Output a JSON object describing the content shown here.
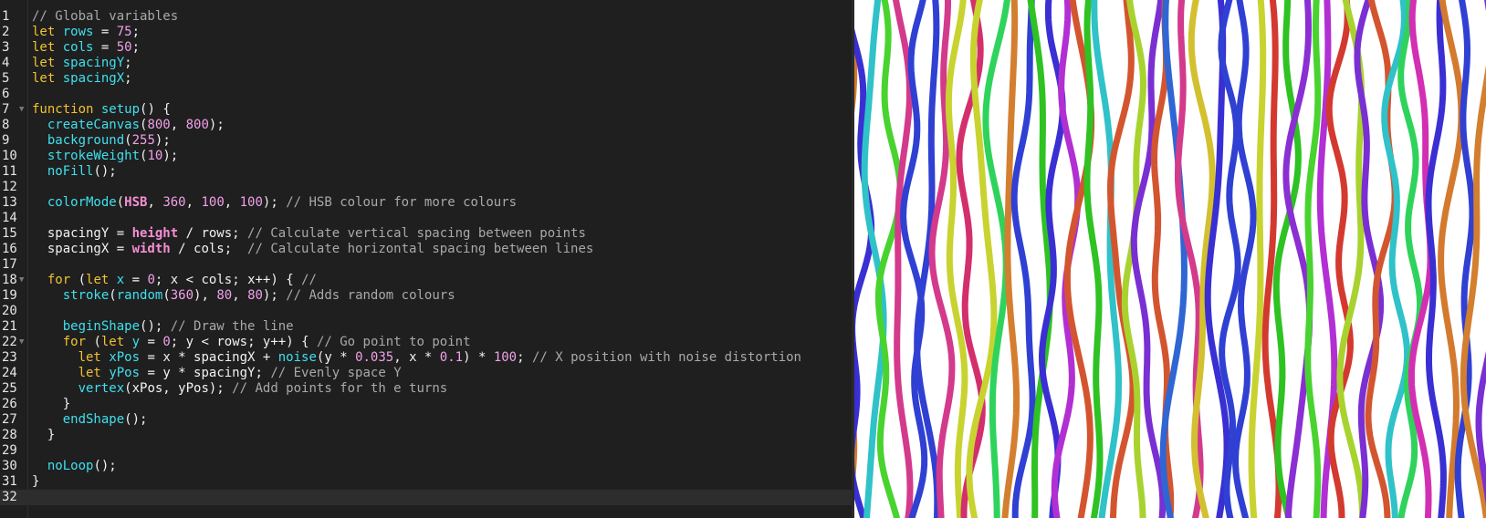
{
  "editor": {
    "lines": [
      {
        "n": "1",
        "tokens": [
          [
            "comment",
            "// Global variables"
          ]
        ]
      },
      {
        "n": "2",
        "tokens": [
          [
            "kw",
            "let"
          ],
          [
            "plain",
            " "
          ],
          [
            "var",
            "rows"
          ],
          [
            "plain",
            " = "
          ],
          [
            "num",
            "75"
          ],
          [
            "plain",
            ";"
          ]
        ]
      },
      {
        "n": "3",
        "tokens": [
          [
            "kw",
            "let"
          ],
          [
            "plain",
            " "
          ],
          [
            "var",
            "cols"
          ],
          [
            "plain",
            " = "
          ],
          [
            "num",
            "50"
          ],
          [
            "plain",
            ";"
          ]
        ]
      },
      {
        "n": "4",
        "tokens": [
          [
            "kw",
            "let"
          ],
          [
            "plain",
            " "
          ],
          [
            "var",
            "spacingY"
          ],
          [
            "plain",
            ";"
          ]
        ]
      },
      {
        "n": "5",
        "tokens": [
          [
            "kw",
            "let"
          ],
          [
            "plain",
            " "
          ],
          [
            "var",
            "spacingX"
          ],
          [
            "plain",
            ";"
          ]
        ]
      },
      {
        "n": "6",
        "tokens": []
      },
      {
        "n": "7",
        "fold": true,
        "tokens": [
          [
            "kw",
            "function"
          ],
          [
            "plain",
            " "
          ],
          [
            "fn",
            "setup"
          ],
          [
            "plain",
            "() {"
          ]
        ]
      },
      {
        "n": "8",
        "tokens": [
          [
            "plain",
            "  "
          ],
          [
            "fn",
            "createCanvas"
          ],
          [
            "plain",
            "("
          ],
          [
            "num",
            "800"
          ],
          [
            "plain",
            ", "
          ],
          [
            "num",
            "800"
          ],
          [
            "plain",
            ");"
          ]
        ]
      },
      {
        "n": "9",
        "tokens": [
          [
            "plain",
            "  "
          ],
          [
            "fn",
            "background"
          ],
          [
            "plain",
            "("
          ],
          [
            "num",
            "255"
          ],
          [
            "plain",
            ");"
          ]
        ]
      },
      {
        "n": "10",
        "tokens": [
          [
            "plain",
            "  "
          ],
          [
            "fn",
            "strokeWeight"
          ],
          [
            "plain",
            "("
          ],
          [
            "num",
            "10"
          ],
          [
            "plain",
            ");"
          ]
        ]
      },
      {
        "n": "11",
        "tokens": [
          [
            "plain",
            "  "
          ],
          [
            "fn",
            "noFill"
          ],
          [
            "plain",
            "();"
          ]
        ]
      },
      {
        "n": "12",
        "tokens": []
      },
      {
        "n": "13",
        "tokens": [
          [
            "plain",
            "  "
          ],
          [
            "fn",
            "colorMode"
          ],
          [
            "plain",
            "("
          ],
          [
            "const",
            "HSB"
          ],
          [
            "plain",
            ", "
          ],
          [
            "num",
            "360"
          ],
          [
            "plain",
            ", "
          ],
          [
            "num",
            "100"
          ],
          [
            "plain",
            ", "
          ],
          [
            "num",
            "100"
          ],
          [
            "plain",
            "); "
          ],
          [
            "comment",
            "// HSB colour for more colours"
          ]
        ]
      },
      {
        "n": "14",
        "tokens": []
      },
      {
        "n": "15",
        "tokens": [
          [
            "plain",
            "  spacingY = "
          ],
          [
            "const",
            "height"
          ],
          [
            "plain",
            " / rows; "
          ],
          [
            "comment",
            "// Calculate vertical spacing between points"
          ]
        ]
      },
      {
        "n": "16",
        "tokens": [
          [
            "plain",
            "  spacingX = "
          ],
          [
            "const",
            "width"
          ],
          [
            "plain",
            " / cols;  "
          ],
          [
            "comment",
            "// Calculate horizontal spacing between lines"
          ]
        ]
      },
      {
        "n": "17",
        "tokens": []
      },
      {
        "n": "18",
        "fold": true,
        "tokens": [
          [
            "plain",
            "  "
          ],
          [
            "kw",
            "for"
          ],
          [
            "plain",
            " ("
          ],
          [
            "kw",
            "let"
          ],
          [
            "plain",
            " "
          ],
          [
            "var",
            "x"
          ],
          [
            "plain",
            " = "
          ],
          [
            "num",
            "0"
          ],
          [
            "plain",
            "; x < cols; x++) { "
          ],
          [
            "comment",
            "//"
          ]
        ]
      },
      {
        "n": "19",
        "tokens": [
          [
            "plain",
            "    "
          ],
          [
            "fn",
            "stroke"
          ],
          [
            "plain",
            "("
          ],
          [
            "fn",
            "random"
          ],
          [
            "plain",
            "("
          ],
          [
            "num",
            "360"
          ],
          [
            "plain",
            "), "
          ],
          [
            "num",
            "80"
          ],
          [
            "plain",
            ", "
          ],
          [
            "num",
            "80"
          ],
          [
            "plain",
            "); "
          ],
          [
            "comment",
            "// Adds random colours"
          ]
        ]
      },
      {
        "n": "20",
        "tokens": []
      },
      {
        "n": "21",
        "tokens": [
          [
            "plain",
            "    "
          ],
          [
            "fn",
            "beginShape"
          ],
          [
            "plain",
            "(); "
          ],
          [
            "comment",
            "// Draw the line"
          ]
        ]
      },
      {
        "n": "22",
        "fold": true,
        "tokens": [
          [
            "plain",
            "    "
          ],
          [
            "kw",
            "for"
          ],
          [
            "plain",
            " ("
          ],
          [
            "kw",
            "let"
          ],
          [
            "plain",
            " "
          ],
          [
            "var",
            "y"
          ],
          [
            "plain",
            " = "
          ],
          [
            "num",
            "0"
          ],
          [
            "plain",
            "; y < rows; y++) { "
          ],
          [
            "comment",
            "// Go point to point"
          ]
        ]
      },
      {
        "n": "23",
        "tokens": [
          [
            "plain",
            "      "
          ],
          [
            "kw",
            "let"
          ],
          [
            "plain",
            " "
          ],
          [
            "var",
            "xPos"
          ],
          [
            "plain",
            " = x * spacingX + "
          ],
          [
            "fn",
            "noise"
          ],
          [
            "plain",
            "(y * "
          ],
          [
            "num",
            "0.035"
          ],
          [
            "plain",
            ", x * "
          ],
          [
            "num",
            "0.1"
          ],
          [
            "plain",
            ") * "
          ],
          [
            "num",
            "100"
          ],
          [
            "plain",
            "; "
          ],
          [
            "comment",
            "// X position with noise distortion"
          ]
        ]
      },
      {
        "n": "24",
        "tokens": [
          [
            "plain",
            "      "
          ],
          [
            "kw",
            "let"
          ],
          [
            "plain",
            " "
          ],
          [
            "var",
            "yPos"
          ],
          [
            "plain",
            " = y * spacingY; "
          ],
          [
            "comment",
            "// Evenly space Y"
          ]
        ]
      },
      {
        "n": "25",
        "tokens": [
          [
            "plain",
            "      "
          ],
          [
            "fn",
            "vertex"
          ],
          [
            "plain",
            "(xPos, yPos); "
          ],
          [
            "comment",
            "// Add points for th e turns"
          ]
        ]
      },
      {
        "n": "26",
        "tokens": [
          [
            "plain",
            "    }"
          ]
        ]
      },
      {
        "n": "27",
        "tokens": [
          [
            "plain",
            "    "
          ],
          [
            "fn",
            "endShape"
          ],
          [
            "plain",
            "();"
          ]
        ]
      },
      {
        "n": "28",
        "tokens": [
          [
            "plain",
            "  }"
          ]
        ]
      },
      {
        "n": "29",
        "tokens": []
      },
      {
        "n": "30",
        "tokens": [
          [
            "plain",
            "  "
          ],
          [
            "fn",
            "noLoop"
          ],
          [
            "plain",
            "();"
          ]
        ]
      },
      {
        "n": "31",
        "tokens": [
          [
            "plain",
            "}"
          ]
        ]
      },
      {
        "n": "32",
        "active": true,
        "tokens": []
      }
    ]
  },
  "colors": {
    "editor_bg": "#1f1f1f",
    "comment": "#a9a9a9",
    "keyword": "#f2c230",
    "identifier": "#3fe0ee",
    "number": "#f0a0e8",
    "constant": "#f58fd5",
    "canvas_bg": "#ffffff"
  },
  "preview": {
    "stroke_colors": [
      "#b22fd3",
      "#2ec222",
      "#8a2fd3",
      "#d33a8c",
      "#2fb8c8",
      "#3a2fd3",
      "#c23d8e",
      "#d37a2f",
      "#22c2a0",
      "#a8d32f",
      "#d3392f",
      "#2f66d3",
      "#d32f6c",
      "#49d32f",
      "#c8d32f",
      "#d37f2f",
      "#2f93d3",
      "#7a2fd3",
      "#d3c02f",
      "#2fd35b",
      "#d32fb2",
      "#2f40d3",
      "#2fc2c8",
      "#d3552f"
    ]
  }
}
